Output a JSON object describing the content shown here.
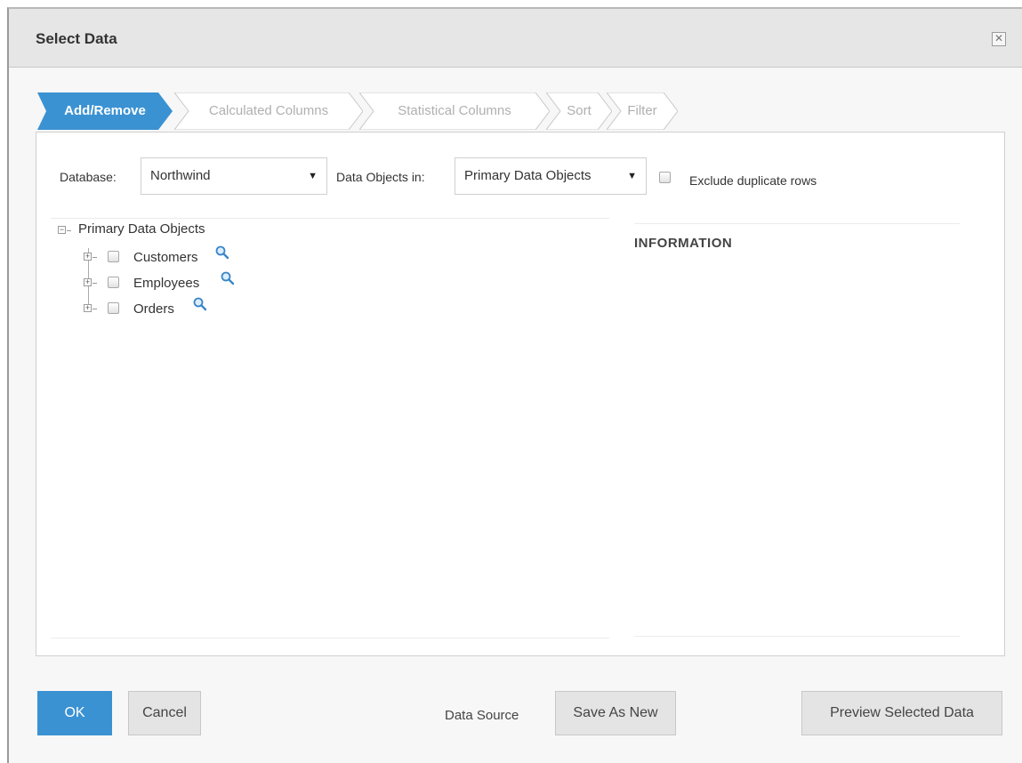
{
  "dialog": {
    "title": "Select Data",
    "close_glyph": "✕"
  },
  "steps": [
    {
      "label": "Add/Remove",
      "active": true
    },
    {
      "label": "Calculated Columns",
      "active": false
    },
    {
      "label": "Statistical Columns",
      "active": false
    },
    {
      "label": "Sort",
      "active": false
    },
    {
      "label": "Filter",
      "active": false
    }
  ],
  "form": {
    "database_label": "Database:",
    "database_value": "Northwind",
    "data_objects_label": "Data Objects in:",
    "data_objects_value": "Primary Data Objects",
    "exclude_label": "Exclude duplicate rows",
    "dropdown_arrow": "▼"
  },
  "tree": {
    "root": {
      "label": "Primary Data Objects",
      "expander": "−"
    },
    "items": [
      {
        "label": "Customers",
        "expander": "+"
      },
      {
        "label": "Employees",
        "expander": "+"
      },
      {
        "label": "Orders",
        "expander": "+"
      }
    ]
  },
  "info": {
    "title": "INFORMATION"
  },
  "footer": {
    "ok_label": "OK",
    "cancel_label": "Cancel",
    "data_source_label": "Data Source",
    "save_as_new_label": "Save As New",
    "preview_label": "Preview Selected Data"
  },
  "colors": {
    "accent": "#3b92d2",
    "inactive_step": "#b0b0b0"
  }
}
